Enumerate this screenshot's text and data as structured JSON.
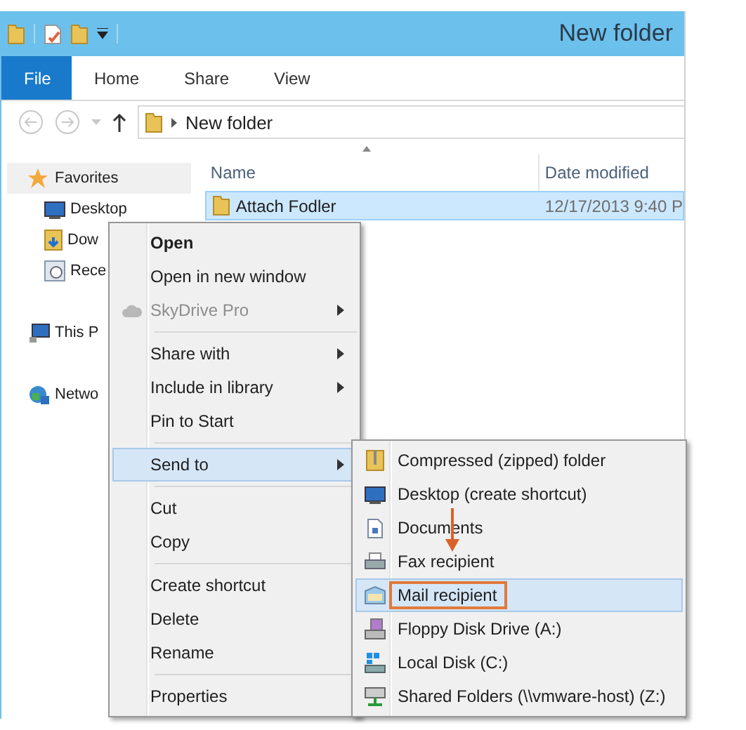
{
  "window": {
    "title": "New folder"
  },
  "ribbon_tabs": [
    {
      "label": "File",
      "selected": true
    },
    {
      "label": "Home",
      "selected": false
    },
    {
      "label": "Share",
      "selected": false
    },
    {
      "label": "View",
      "selected": false
    }
  ],
  "address_bar": {
    "path": "New folder"
  },
  "navigation": [
    {
      "label": "Favorites",
      "selected": true,
      "children": [
        {
          "label": "Desktop",
          "selected": false
        },
        {
          "label": "Dow",
          "selected": false
        },
        {
          "label": "Rece",
          "selected": false
        }
      ]
    },
    {
      "label": "This P",
      "selected": false
    },
    {
      "label": "Netwo",
      "selected": false
    }
  ],
  "file_list": {
    "columns": [
      "Name",
      "Date modified"
    ],
    "rows": [
      {
        "name": "Attach Fodler",
        "date": "12/17/2013 9:40 P",
        "selected": true
      }
    ]
  },
  "context_menu": {
    "items": [
      {
        "kind": "item",
        "label": "Open",
        "bold": true,
        "disabled": false,
        "submenu": false,
        "selected": false
      },
      {
        "kind": "item",
        "label": "Open in new window",
        "bold": false,
        "disabled": false,
        "submenu": false,
        "selected": false
      },
      {
        "kind": "item",
        "label": "SkyDrive Pro",
        "bold": false,
        "disabled": true,
        "submenu": true,
        "selected": false
      },
      {
        "kind": "separator"
      },
      {
        "kind": "item",
        "label": "Share with",
        "bold": false,
        "disabled": false,
        "submenu": true,
        "selected": false
      },
      {
        "kind": "item",
        "label": "Include in library",
        "bold": false,
        "disabled": false,
        "submenu": true,
        "selected": false
      },
      {
        "kind": "item",
        "label": "Pin to Start",
        "bold": false,
        "disabled": false,
        "submenu": false,
        "selected": false
      },
      {
        "kind": "separator"
      },
      {
        "kind": "item",
        "label": "Send to",
        "bold": false,
        "disabled": false,
        "submenu": true,
        "selected": true
      },
      {
        "kind": "separator"
      },
      {
        "kind": "item",
        "label": "Cut",
        "bold": false,
        "disabled": false,
        "submenu": false,
        "selected": false
      },
      {
        "kind": "item",
        "label": "Copy",
        "bold": false,
        "disabled": false,
        "submenu": false,
        "selected": false
      },
      {
        "kind": "separator"
      },
      {
        "kind": "item",
        "label": "Create shortcut",
        "bold": false,
        "disabled": false,
        "submenu": false,
        "selected": false
      },
      {
        "kind": "item",
        "label": "Delete",
        "bold": false,
        "disabled": false,
        "submenu": false,
        "selected": false
      },
      {
        "kind": "item",
        "label": "Rename",
        "bold": false,
        "disabled": false,
        "submenu": false,
        "selected": false
      },
      {
        "kind": "separator"
      },
      {
        "kind": "item",
        "label": "Properties",
        "bold": false,
        "disabled": false,
        "submenu": false,
        "selected": false
      }
    ]
  },
  "send_to_menu": {
    "items": [
      {
        "label": "Compressed (zipped) folder",
        "selected": false,
        "highlighted": false
      },
      {
        "label": "Desktop (create shortcut)",
        "selected": false,
        "highlighted": false
      },
      {
        "label": "Documents",
        "selected": false,
        "highlighted": false
      },
      {
        "label": "Fax recipient",
        "selected": false,
        "highlighted": false
      },
      {
        "label": "Mail recipient",
        "selected": true,
        "highlighted": true
      },
      {
        "label": "Floppy Disk Drive (A:)",
        "selected": false,
        "highlighted": false
      },
      {
        "label": "Local Disk (C:)",
        "selected": false,
        "highlighted": false
      },
      {
        "label": "Shared Folders (\\\\vmware-host) (Z:)",
        "selected": false,
        "highlighted": false
      }
    ]
  }
}
